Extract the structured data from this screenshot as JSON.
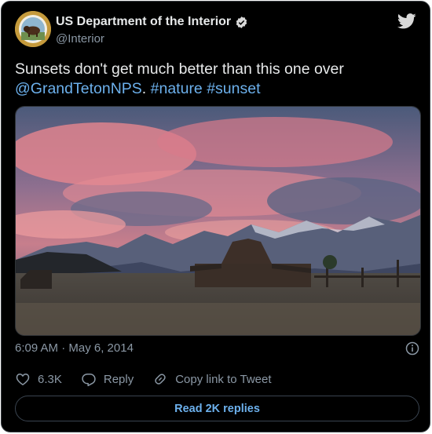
{
  "author": {
    "display_name": "US Department of the Interior",
    "handle": "@Interior"
  },
  "tweet": {
    "text_start": "Sunsets don't get much better than this one over",
    "mention": "@GrandTetonNPS",
    "separator": ".",
    "hashtag_1": "#nature",
    "hashtag_2": "#sunset"
  },
  "timestamp": "6:09 AM · May 6, 2014",
  "actions": {
    "likes_count": "6.3K",
    "reply_label": "Reply",
    "copy_link_label": "Copy link to Tweet"
  },
  "replies_button_label": "Read 2K replies",
  "icons": [
    "twitter-bird-icon",
    "verified-badge-icon",
    "info-icon",
    "heart-icon",
    "reply-icon",
    "link-icon"
  ],
  "colors": {
    "background": "#000000",
    "link": "#6cb0ec",
    "secondary_text": "#8b98a5",
    "primary_text": "#e7e9ea"
  }
}
